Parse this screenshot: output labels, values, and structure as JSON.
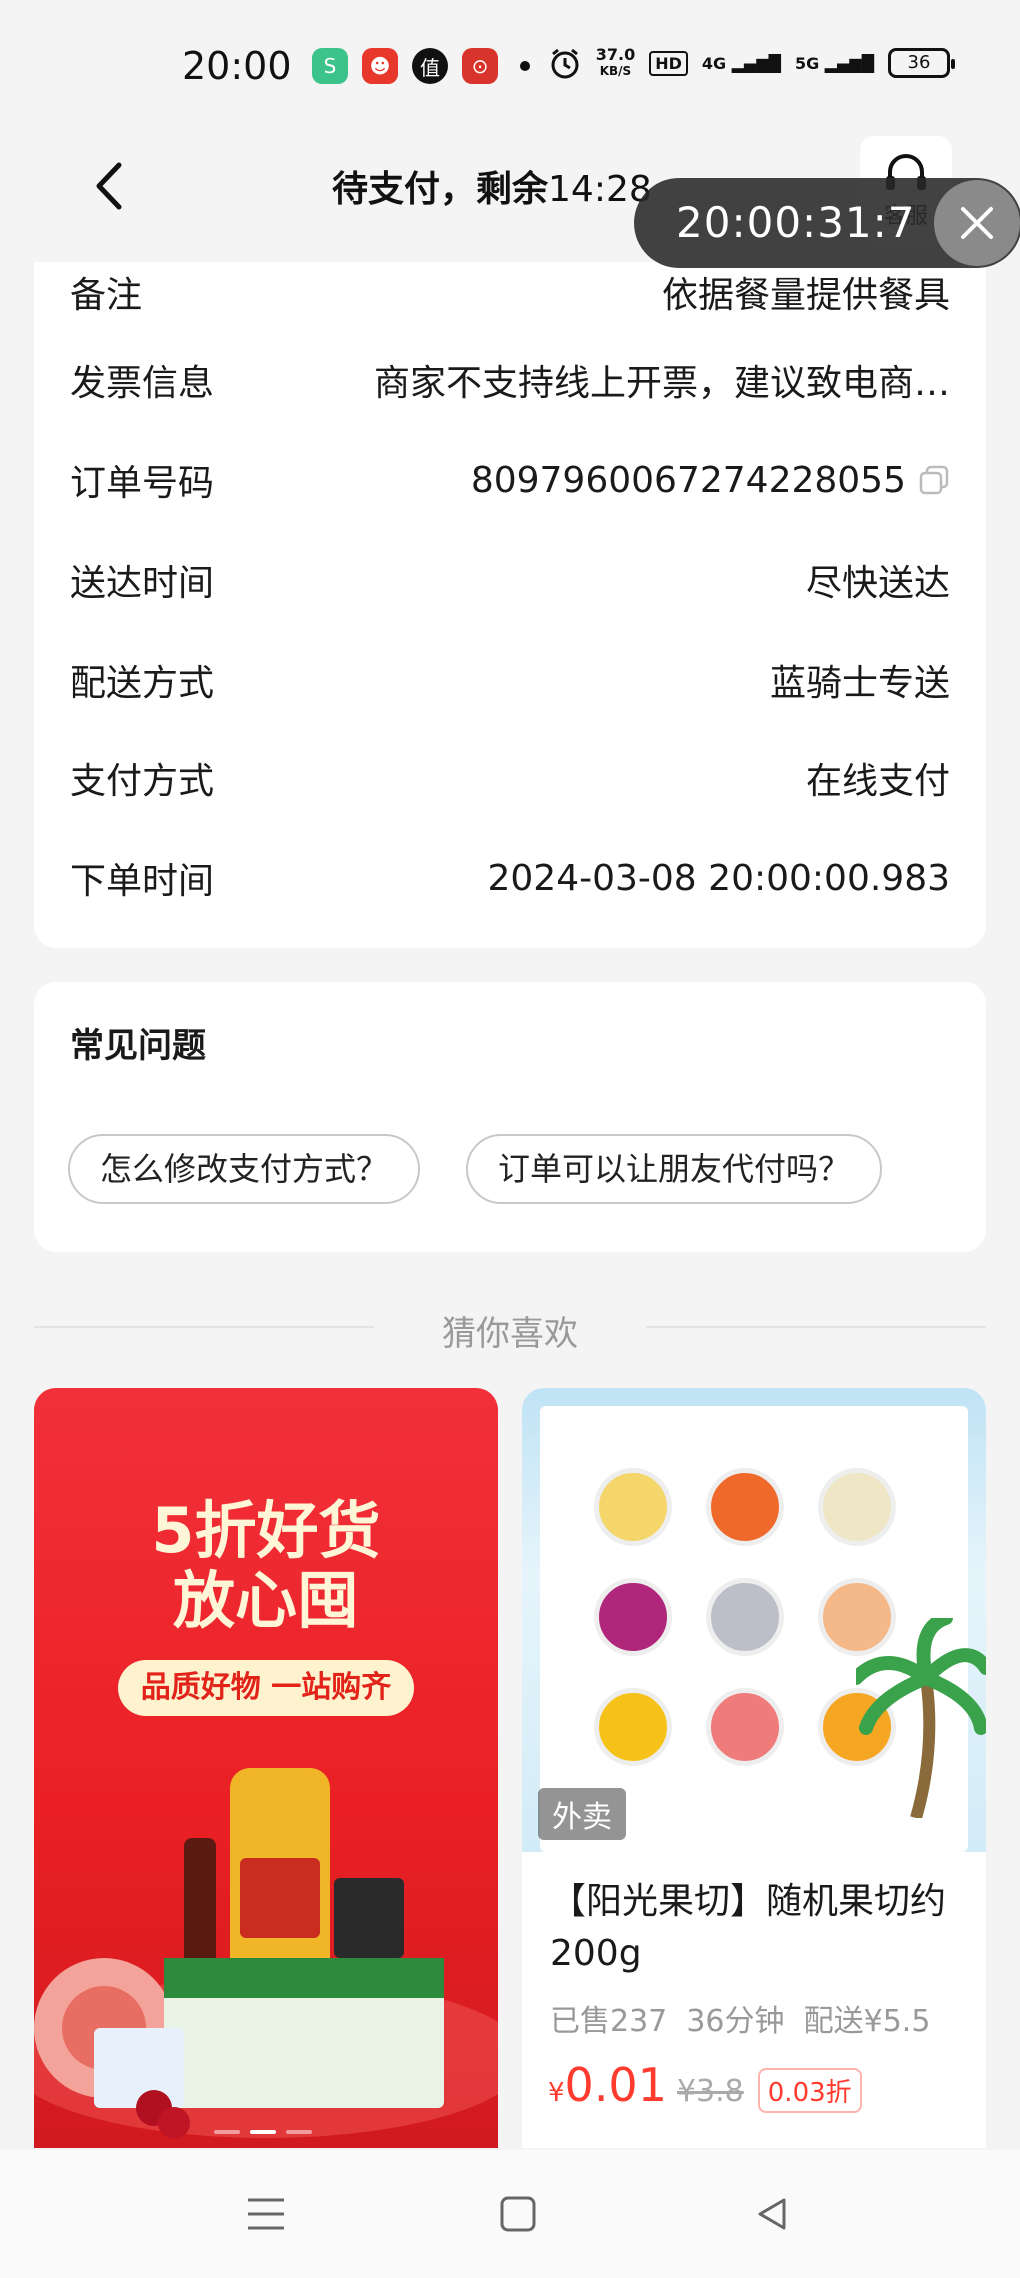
{
  "status_bar": {
    "time": "20:00",
    "apps": [
      "S",
      "☻",
      "值",
      "⊙"
    ],
    "speed_value": "37.0",
    "speed_unit": "KB/S",
    "hd": "HD",
    "net1": "4G",
    "net2": "5G",
    "battery": "36"
  },
  "header": {
    "title": "待支付，剩余",
    "countdown": "14:28",
    "service_label": "客服"
  },
  "timer_overlay": {
    "time": "20:00:31:7"
  },
  "order_info": [
    {
      "label": "备注",
      "value": "依据餐量提供餐具"
    },
    {
      "label": "发票信息",
      "value": "商家不支持线上开票，建议致电商…"
    },
    {
      "label": "订单号码",
      "value": "8097960067274228055"
    },
    {
      "label": "送达时间",
      "value": "尽快送达"
    },
    {
      "label": "配送方式",
      "value": "蓝骑士专送"
    },
    {
      "label": "支付方式",
      "value": "在线支付"
    },
    {
      "label": "下单时间",
      "value": "2024-03-08 20:00:00.983"
    }
  ],
  "faq": {
    "title": "常见问题",
    "chips": [
      "怎么修改支付方式？",
      "订单可以让朋友代付吗？"
    ]
  },
  "recommend": {
    "title": "猜你喜欢",
    "promo": {
      "title_line1": "5折好货",
      "title_line2": "放心囤",
      "pill": "品质好物 一站购齐"
    },
    "product": {
      "tag": "外卖",
      "name": "【阳光果切】随机果切约200g",
      "sold": "已售237",
      "time": "36分钟",
      "delivery": "配送¥5.5",
      "currency": "¥",
      "price": "0.01",
      "original_price": "¥3.8",
      "discount": "0.03折"
    }
  },
  "colors": {
    "accent": "#ff3a2f",
    "promo_red": "#ea2024"
  }
}
